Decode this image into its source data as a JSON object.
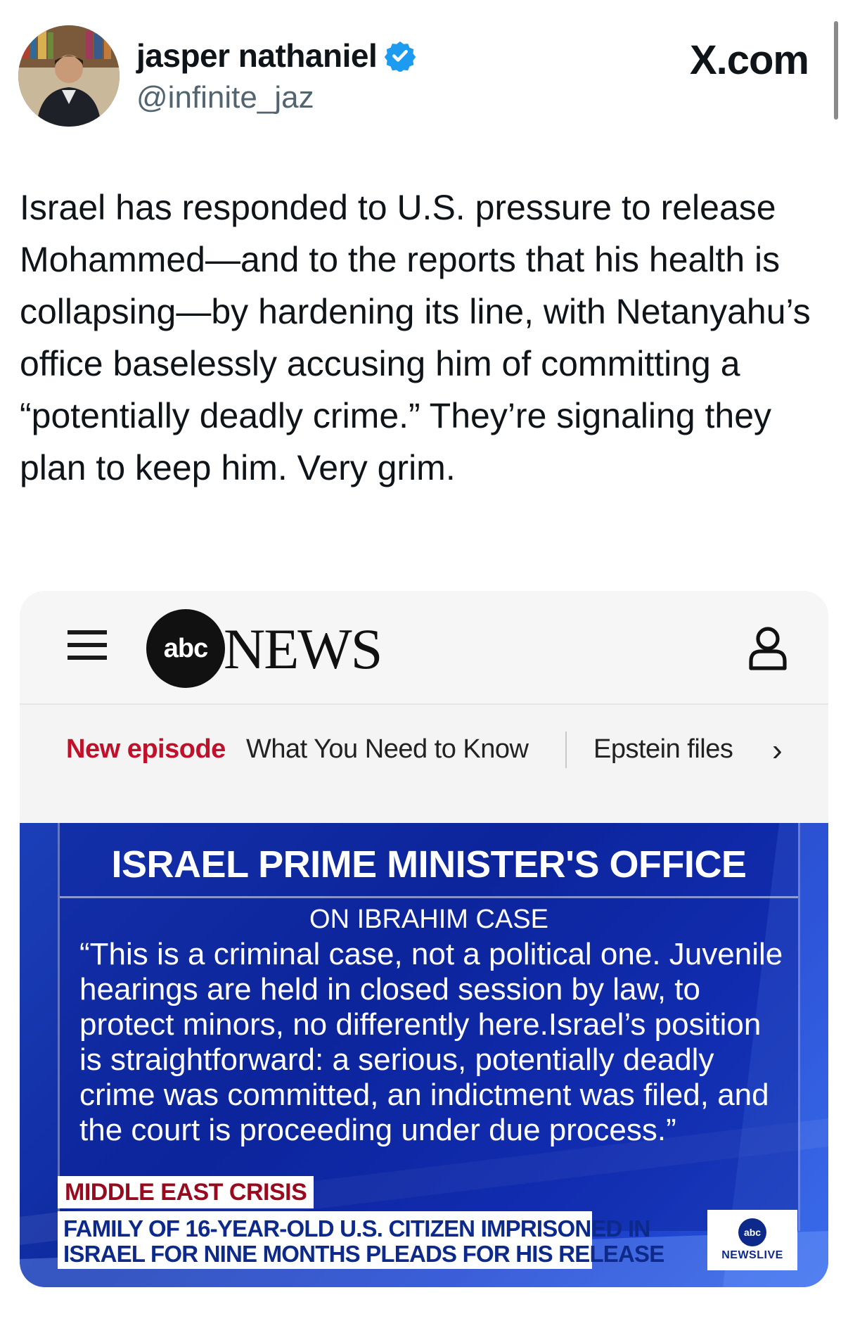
{
  "post": {
    "author_name": "jasper nathaniel",
    "handle": "@infinite_jaz",
    "site": "X.com",
    "verified_icon": "verified-badge-icon",
    "text": "Israel has responded to U.S. pressure to release Mohammed—and to the reports that his health is collapsing—by hardening its line, with Netanyahu’s office baselessly accusing him of committing a “potentially deadly crime.” They’re signaling they plan to keep him. Very grim."
  },
  "card": {
    "abc_logo_text": "abc",
    "news_word": "NEWS",
    "ticker": {
      "new_episode": "New episode",
      "show": "What You Need to Know",
      "topic": "Epstein files",
      "chevron": "›"
    },
    "broadcast": {
      "title": "ISRAEL PRIME MINISTER'S OFFICE",
      "subtitle": "ON IBRAHIM CASE",
      "quote": "“This is a criminal case, not a political one. Juvenile hearings are held in closed session by law, to protect minors, no differently here.Israel’s position is straightforward: a serious, potentially deadly crime was committed, an indictment was filed, and the court is proceeding under due process.”",
      "tag": "MIDDLE EAST CRISIS",
      "lower_third_line1": "FAMILY OF 16-YEAR-OLD U.S. CITIZEN IMPRISONED IN",
      "lower_third_line2": "ISRAEL FOR NINE MONTHS PLEADS FOR HIS RELEASE",
      "bug_logo": "abc",
      "bug_text": "NEWSLIVE"
    }
  },
  "colors": {
    "accent_red": "#c0102a",
    "verified_blue": "#1d9bf0",
    "broadcast_blue": "#1637c4"
  }
}
